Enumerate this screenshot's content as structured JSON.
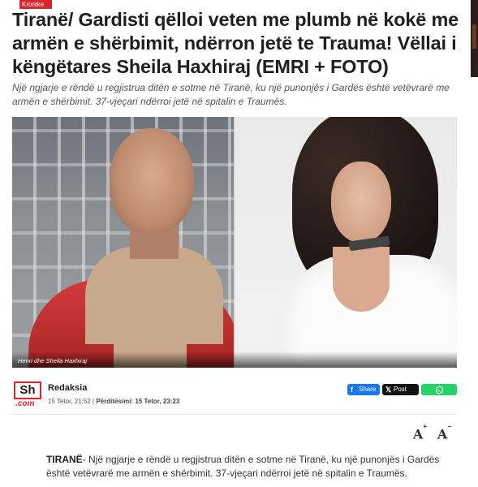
{
  "category": "Kronike",
  "headline": "Tiranë/ Gardisti qëlloi veten me plumb në kokë me armën e shërbimit, ndërron jetë te Trauma! Vëllai i këngëtares Sheila Haxhiraj (EMRI + FOTO)",
  "lead": "Një ngjarje e rëndë u regjistrua ditën e sotme në Tiranë, ku një punonjës i Gardës është vetëvrarë me armën e shërbimit. 37-vjeçari ndërroi jetë në spitalin e Traumës.",
  "photo": {
    "caption": "Henri dhe Sheila Haxhiraj"
  },
  "byline": {
    "logo_main": "Sh",
    "logo_suffix": ".com",
    "author": "Redaksia",
    "published": "15 Tetor, 21:52",
    "separator": "|",
    "updated_label": "Përditësimi: 15 Tetor, 23:23"
  },
  "share": {
    "facebook_label": "Share",
    "x_label": "Post",
    "facebook_icon": "facebook-icon",
    "x_icon": "x-icon",
    "whatsapp_icon": "whatsapp-icon",
    "facebook_color": "#1877f2",
    "x_color": "#111111",
    "whatsapp_color": "#25d366"
  },
  "font_controls": {
    "increase_glyph": "A",
    "increase_mark": "+",
    "decrease_glyph": "A",
    "decrease_mark": "−"
  },
  "body": {
    "dateline": "TIRANË",
    "text": "- Një ngjarje e rëndë u regjistrua ditën e sotme në Tiranë, ku një punonjës i Gardës është vetëvrarë me armën e shërbimit. 37-vjeçari ndërroi jetë në spitalin e Traumës."
  },
  "colors": {
    "accent": "#d8262c"
  }
}
